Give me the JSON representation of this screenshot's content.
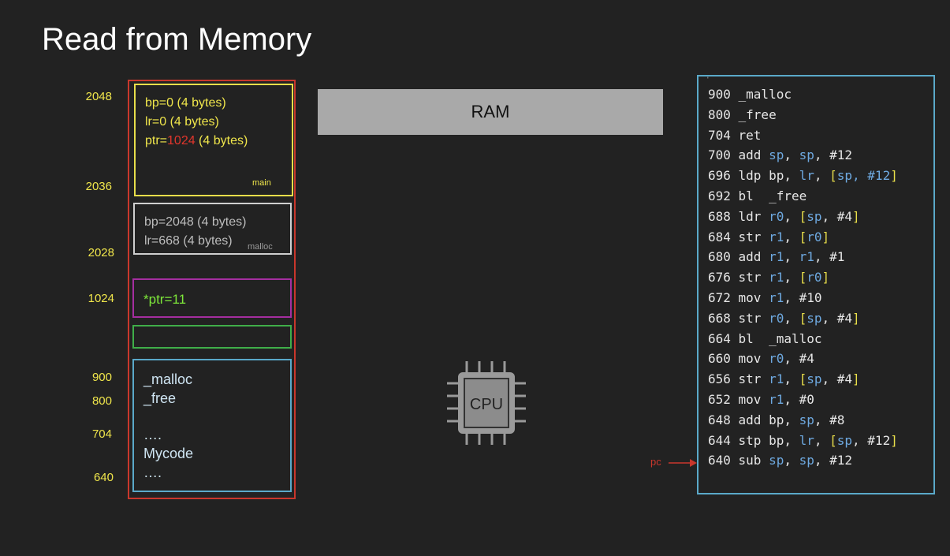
{
  "title": "Read from Memory",
  "addresses": [
    "2048",
    "2036",
    "2028",
    "1024",
    "900",
    "800",
    "704",
    "640"
  ],
  "frame_main": {
    "lines": [
      {
        "pre": "bp=0 (4 bytes)",
        "hl": "",
        "post": ""
      },
      {
        "pre": "lr=0  (4 bytes)",
        "hl": "",
        "post": ""
      },
      {
        "pre": "ptr=",
        "hl": "1024",
        "post": " (4 bytes)"
      }
    ],
    "label": "main"
  },
  "frame_malloc": {
    "lines": [
      "bp=2048 (4 bytes)",
      "lr=668  (4 bytes)"
    ],
    "label": "malloc"
  },
  "heap": {
    "value": "*ptr=11"
  },
  "code_region": {
    "lines": [
      "_malloc",
      "_free",
      "….",
      "Mycode",
      "…."
    ]
  },
  "ram_label": "RAM",
  "cpu_label": "CPU",
  "pc_label": "pc",
  "listing_marker": "'",
  "listing": [
    {
      "addr": "900",
      "tokens": [
        [
          "plain",
          "_malloc"
        ]
      ]
    },
    {
      "addr": "800",
      "tokens": [
        [
          "plain",
          "_free"
        ]
      ]
    },
    {
      "addr": "704",
      "tokens": [
        [
          "plain",
          "ret"
        ]
      ]
    },
    {
      "addr": "700",
      "tokens": [
        [
          "plain",
          "add "
        ],
        [
          "reg",
          "sp"
        ],
        [
          "plain",
          ", "
        ],
        [
          "reg",
          "sp"
        ],
        [
          "plain",
          ", #12"
        ]
      ]
    },
    {
      "addr": "696",
      "tokens": [
        [
          "plain",
          "ldp bp, "
        ],
        [
          "reg",
          "lr"
        ],
        [
          "plain",
          ", "
        ],
        [
          "br",
          "["
        ],
        [
          "reg",
          "sp, #12"
        ],
        [
          "br",
          "]"
        ]
      ]
    },
    {
      "addr": "692",
      "tokens": [
        [
          "plain",
          "bl  _free"
        ]
      ]
    },
    {
      "addr": "688",
      "tokens": [
        [
          "plain",
          "ldr "
        ],
        [
          "reg",
          "r0"
        ],
        [
          "plain",
          ", "
        ],
        [
          "br",
          "["
        ],
        [
          "reg",
          "sp"
        ],
        [
          "plain",
          ", #4"
        ],
        [
          "br",
          "]"
        ]
      ]
    },
    {
      "addr": "684",
      "tokens": [
        [
          "plain",
          "str "
        ],
        [
          "reg",
          "r1"
        ],
        [
          "plain",
          ", "
        ],
        [
          "br",
          "["
        ],
        [
          "reg",
          "r0"
        ],
        [
          "br",
          "]"
        ]
      ]
    },
    {
      "addr": "680",
      "tokens": [
        [
          "plain",
          "add "
        ],
        [
          "reg",
          "r1"
        ],
        [
          "plain",
          ", "
        ],
        [
          "reg",
          "r1"
        ],
        [
          "plain",
          ", #1"
        ]
      ]
    },
    {
      "addr": "676",
      "tokens": [
        [
          "plain",
          "str "
        ],
        [
          "reg",
          "r1"
        ],
        [
          "plain",
          ", "
        ],
        [
          "br",
          "["
        ],
        [
          "reg",
          "r0"
        ],
        [
          "br",
          "]"
        ]
      ]
    },
    {
      "addr": "672",
      "tokens": [
        [
          "plain",
          "mov "
        ],
        [
          "reg",
          "r1"
        ],
        [
          "plain",
          ", #10"
        ]
      ]
    },
    {
      "addr": "668",
      "tokens": [
        [
          "plain",
          "str "
        ],
        [
          "reg",
          "r0"
        ],
        [
          "plain",
          ", "
        ],
        [
          "br",
          "["
        ],
        [
          "reg",
          "sp"
        ],
        [
          "plain",
          ", #4"
        ],
        [
          "br",
          "]"
        ]
      ]
    },
    {
      "addr": "664",
      "tokens": [
        [
          "plain",
          "bl  _malloc"
        ]
      ]
    },
    {
      "addr": "660",
      "tokens": [
        [
          "plain",
          "mov "
        ],
        [
          "reg",
          "r0"
        ],
        [
          "plain",
          ", #4"
        ]
      ]
    },
    {
      "addr": "656",
      "tokens": [
        [
          "plain",
          "str "
        ],
        [
          "reg",
          "r1"
        ],
        [
          "plain",
          ", "
        ],
        [
          "br",
          "["
        ],
        [
          "reg",
          "sp"
        ],
        [
          "plain",
          ", #4"
        ],
        [
          "br",
          "]"
        ]
      ]
    },
    {
      "addr": "652",
      "tokens": [
        [
          "plain",
          "mov "
        ],
        [
          "reg",
          "r1"
        ],
        [
          "plain",
          ", #0"
        ]
      ]
    },
    {
      "addr": "648",
      "tokens": [
        [
          "plain",
          "add bp, "
        ],
        [
          "reg",
          "sp"
        ],
        [
          "plain",
          ", #8"
        ]
      ]
    },
    {
      "addr": "644",
      "tokens": [
        [
          "plain",
          "stp bp, "
        ],
        [
          "reg",
          "lr"
        ],
        [
          "plain",
          ", "
        ],
        [
          "br",
          "["
        ],
        [
          "reg",
          "sp"
        ],
        [
          "plain",
          ", #12"
        ],
        [
          "br",
          "]"
        ]
      ]
    },
    {
      "addr": "640",
      "tokens": [
        [
          "plain",
          "sub "
        ],
        [
          "reg",
          "sp"
        ],
        [
          "plain",
          ", "
        ],
        [
          "reg",
          "sp"
        ],
        [
          "plain",
          ", #12"
        ]
      ]
    }
  ],
  "colors": {
    "background": "#222222",
    "address_yellow": "#f0e64b",
    "stack_outer_red": "#c9372c",
    "frame_main_yellow": "#e8de4a",
    "frame_malloc_gray": "#cfcfcf",
    "heap_purple": "#a52ea0",
    "heap_value_green": "#7ee83a",
    "empty_green": "#3fae49",
    "code_blue": "#5aa9c9",
    "ram_gray": "#a9a9a9",
    "highlight_red": "#e0362c",
    "register_blue": "#6ea9e0"
  }
}
